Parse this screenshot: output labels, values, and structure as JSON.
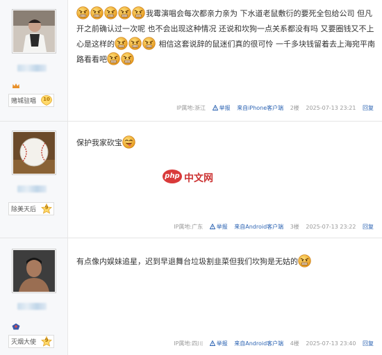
{
  "posts": [
    {
      "user_badge": "赌城驻唱",
      "level": "10",
      "content_parts": [
        "我霉演唱会每次都亲力亲为 下水道老鼠敷衍的要死全包给公司 但凡开之前确认过一次呢 也不会出现这种情况 还说和坎狗一点关系都没有吗 又要圈钱又不上心是这样的",
        "相信这套说辞的鼠迷们真的很可怜 一千多块钱留着去上海宛平南路看看吧"
      ],
      "ip": "IP属地:浙江",
      "report": "举报",
      "client": "来自iPhone客户端",
      "floor": "2楼",
      "time": "2025-07-13 23:21",
      "reply": "回复"
    },
    {
      "user_badge": "除美天后",
      "level": "9",
      "content_parts": [
        "保护我家砍宝"
      ],
      "ip": "IP属地:广东",
      "report": "举报",
      "client": "来自Android客户端",
      "floor": "3楼",
      "time": "2025-07-13 23:22",
      "reply": "回复"
    },
    {
      "user_badge": "灭烟大使",
      "level": "9",
      "content_parts": [
        "有点像内娱妹追星，迟到早退舞台垃圾割韭菜但我们坎狗是无姑的"
      ],
      "ip": "IP属地:四川",
      "report": "举报",
      "client": "来自Android客户端",
      "floor": "4楼",
      "time": "2025-07-13 23:40",
      "reply": "回复"
    }
  ],
  "watermark": {
    "logo": "php",
    "text": "中文网"
  },
  "colors": {
    "link": "#2d64b3",
    "sidebar": "#f7f8fa",
    "emoji": "#f3b23a"
  }
}
